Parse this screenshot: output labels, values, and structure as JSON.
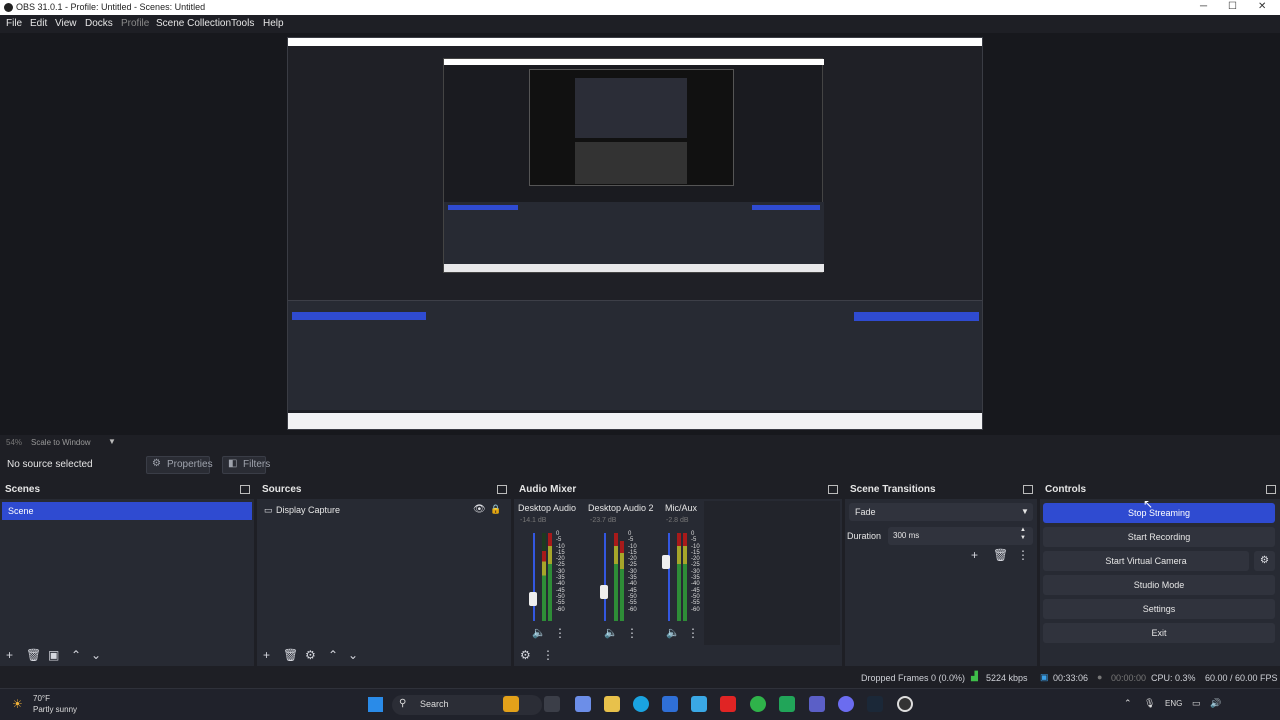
{
  "titlebar": {
    "title": "OBS 31.0.1 - Profile: Untitled - Scenes: Untitled"
  },
  "menu": [
    "File",
    "Edit",
    "View",
    "Docks",
    "Profile",
    "Scene Collection",
    "Tools",
    "Help"
  ],
  "preview": {
    "zoom": "54%",
    "scale_mode": "Scale to Window"
  },
  "source_toolbar": {
    "selection": "No source selected",
    "properties": "Properties",
    "filters": "Filters"
  },
  "scenes": {
    "title": "Scenes",
    "items": [
      "Scene"
    ]
  },
  "sources": {
    "title": "Sources",
    "items": [
      "Display Capture"
    ]
  },
  "audio_mixer": {
    "title": "Audio Mixer",
    "channels": [
      {
        "name": "Desktop Audio",
        "level": "-14.1 dB",
        "fader": 0.2
      },
      {
        "name": "Desktop Audio 2",
        "level": "-23.7 dB",
        "fader": 0.3
      },
      {
        "name": "Mic/Aux",
        "level": "-2.8 dB",
        "fader": 0.7
      }
    ],
    "scale": [
      "0",
      "-5",
      "-10",
      "-15",
      "-20",
      "-25",
      "-30",
      "-35",
      "-40",
      "-45",
      "-50",
      "-55",
      "-60"
    ]
  },
  "scene_transitions": {
    "title": "Scene Transitions",
    "transition": "Fade",
    "duration_label": "Duration",
    "duration": "300 ms"
  },
  "controls": {
    "title": "Controls",
    "stop_streaming": "Stop Streaming",
    "start_recording": "Start Recording",
    "start_virtual_camera": "Start Virtual Camera",
    "studio_mode": "Studio Mode",
    "settings": "Settings",
    "exit": "Exit"
  },
  "status": {
    "dropped_frames": "Dropped Frames 0 (0.0%)",
    "bitrate": "5224 kbps",
    "stream_time": "00:33:06",
    "rec_time": "00:00:00",
    "cpu": "CPU: 0.3%",
    "fps": "60.00 / 60.00 FPS"
  },
  "taskbar": {
    "weather_temp": "70°F",
    "weather_desc": "Partly sunny",
    "search": "Search",
    "lang": "ENG"
  },
  "colors": {
    "accent": "#2f4bd1",
    "bg": "#1e1f25",
    "panel": "#272a33"
  }
}
